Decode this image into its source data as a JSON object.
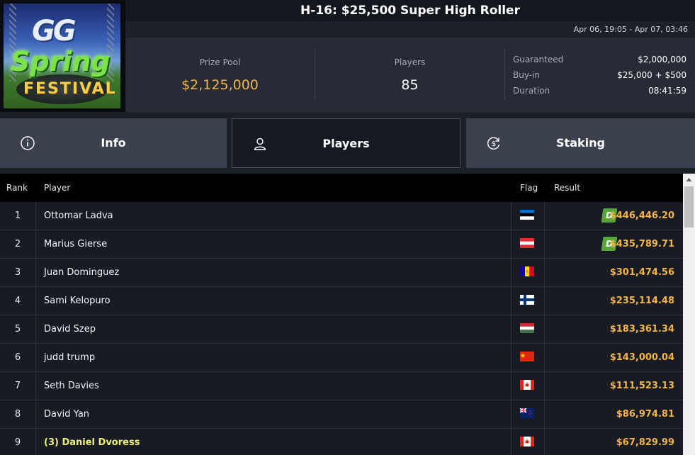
{
  "header": {
    "title": "H-16: $25,500 Super High Roller",
    "date_range": "Apr 06, 19:05 - Apr 07, 03:46"
  },
  "logo": {
    "gg": "GG",
    "spring": "Spring",
    "festival": "FESTIVAL"
  },
  "stats": {
    "prize_pool_label": "Prize Pool",
    "prize_pool_value": "$2,125,000",
    "players_label": "Players",
    "players_value": "85",
    "details": [
      {
        "label": "Guaranteed",
        "value": "$2,000,000"
      },
      {
        "label": "Buy-in",
        "value": "$25,000 + $500"
      },
      {
        "label": "Duration",
        "value": "08:41:59"
      }
    ]
  },
  "tabs": [
    {
      "label": "Info",
      "icon": "info-icon"
    },
    {
      "label": "Players",
      "icon": "user-icon",
      "active": true
    },
    {
      "label": "Staking",
      "icon": "dollar-cycle-icon"
    }
  ],
  "table": {
    "headers": {
      "rank": "Rank",
      "player": "Player",
      "flag": "Flag",
      "result": "Result"
    },
    "rows": [
      {
        "rank": "1",
        "player": "Ottomar Ladva",
        "flag": "EE",
        "result": "$446,446.20",
        "badge": "D"
      },
      {
        "rank": "2",
        "player": "Marius Gierse",
        "flag": "AT",
        "result": "$435,789.71",
        "badge": "D"
      },
      {
        "rank": "3",
        "player": "Juan Dominguez",
        "flag": "AD",
        "result": "$301,474.56"
      },
      {
        "rank": "4",
        "player": "Sami Kelopuro",
        "flag": "FI",
        "result": "$235,114.48"
      },
      {
        "rank": "5",
        "player": "David Szep",
        "flag": "HU",
        "result": "$183,361.34"
      },
      {
        "rank": "6",
        "player": "judd trump",
        "flag": "CN",
        "result": "$143,000.04"
      },
      {
        "rank": "7",
        "player": "Seth Davies",
        "flag": "CA",
        "result": "$111,523.13"
      },
      {
        "rank": "8",
        "player": "David Yan",
        "flag": "NZ",
        "result": "$86,974.81"
      },
      {
        "rank": "9",
        "player": "(3) Daniel Dvoress",
        "flag": "CA",
        "result": "$67,829.99",
        "highlight": true
      }
    ]
  },
  "colors": {
    "accent_gold": "#f0b44c",
    "highlight_yellow": "#eef07a",
    "badge_green": "#5aa53a"
  }
}
